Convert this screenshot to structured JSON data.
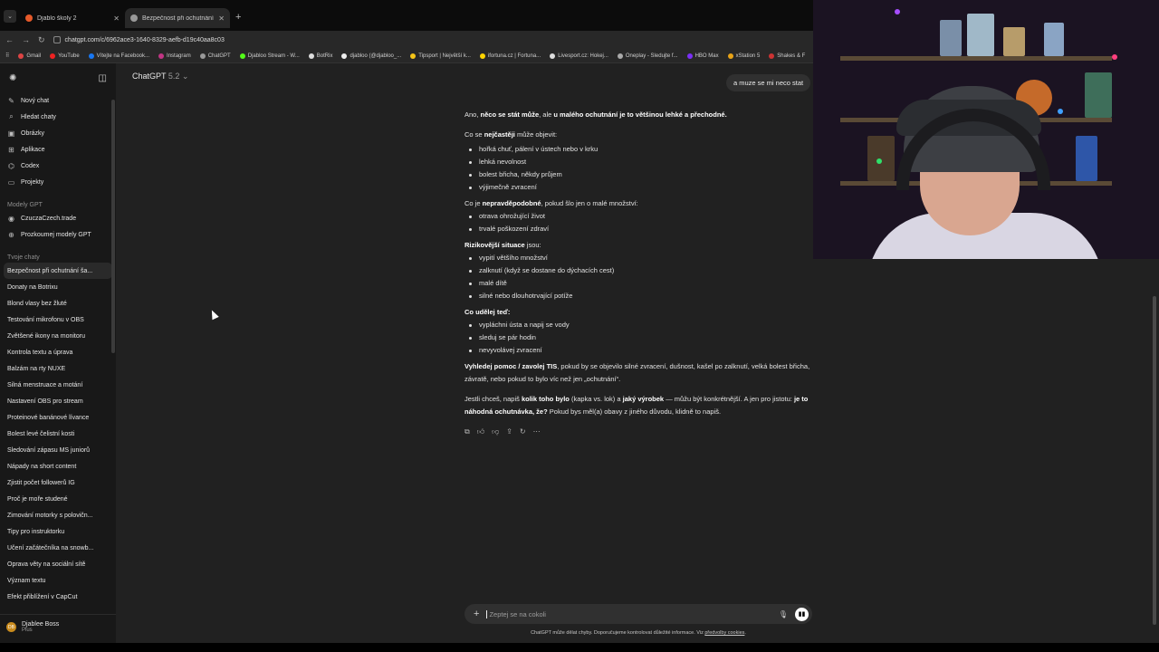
{
  "browser": {
    "tabs": [
      {
        "title": "Djablo školy 2",
        "active": false
      },
      {
        "title": "Bezpečnost při ochutnání šam...",
        "active": true
      }
    ],
    "url": "chatgpt.com/c/6962ace3-1640-8329-aefb-d19c40aa8c03",
    "bookmarks": [
      "Gmail",
      "YouTube",
      "Vítejte na Facebook...",
      "Instagram",
      "ChatGPT",
      "Djabloo Stream - W...",
      "BotRix",
      "djabloo (@djabloo_...",
      "Tipsport | Největší k...",
      "ifortuna.cz | Fortuna...",
      "Livesport.cz: Hokej...",
      "Oneplay - Sledujte f...",
      "HBO Max",
      "xStation 5",
      "Shakes & F"
    ]
  },
  "sidebar": {
    "nav": [
      {
        "icon": "edit-icon",
        "label": "Nový chat"
      },
      {
        "icon": "search-icon",
        "label": "Hledat chaty"
      },
      {
        "icon": "image-icon",
        "label": "Obrázky"
      },
      {
        "icon": "apps-icon",
        "label": "Aplikace"
      },
      {
        "icon": "code-icon",
        "label": "Codex"
      },
      {
        "icon": "folder-icon",
        "label": "Projekty"
      }
    ],
    "gpts_header": "Modely GPT",
    "gpts": [
      "CzuczaCzech.trade",
      "Prozkoumej modely GPT"
    ],
    "chats_header": "Tvoje chaty",
    "chats": [
      "Bezpečnost při ochutnání ša...",
      "Donaty na Botrixu",
      "Blond vlasy bez žluté",
      "Testování mikrofonu v OBS",
      "Zvětšené ikony na monitoru",
      "Kontrola textu a úprava",
      "Balzám na rty NUXE",
      "Silná menstruace a motání",
      "Nastavení OBS pro stream",
      "Proteinové banánové lívance",
      "Bolest levé čelistní kosti",
      "Sledování zápasu MS juniorů",
      "Nápady na short content",
      "Zjistit počet followerů IG",
      "Proč je moře studené",
      "Zimování motorky s polovičn...",
      "Tipy pro instruktorku",
      "Učení začátečníka na snowb...",
      "Oprava věty na sociální sítě",
      "Význam textu",
      "Efekt přiblížení v CapCut"
    ],
    "user": {
      "initials": "DB",
      "name": "Djablee Boss",
      "plan": "Plus"
    }
  },
  "header": {
    "model": "ChatGPT",
    "version": "5.2"
  },
  "conversation": {
    "user_message": "a muze se mi neco stat",
    "intro_a": "Ano, ",
    "intro_b": "něco se stát může",
    "intro_c": ", ale ",
    "intro_d": "u malého ochutnání je to většinou lehké a přechodné.",
    "common_a": "Co se ",
    "common_b": "nejčastěji",
    "common_c": " může objevit:",
    "common_items": [
      "hořká chuť, pálení v ústech nebo v krku",
      "lehká nevolnost",
      "bolest břicha, někdy průjem",
      "výjimečně zvracení"
    ],
    "unlikely_a": "Co je ",
    "unlikely_b": "nepravděpodobné",
    "unlikely_c": ", pokud šlo jen o malé množství:",
    "unlikely_items": [
      "otrava ohrožující život",
      "trvalé poškození zdraví"
    ],
    "risk_b": "Rizikovější situace",
    "risk_c": " jsou:",
    "risk_items": [
      "vypití většího množství",
      "zalknutí (když se dostane do dýchacích cest)",
      "malé dítě",
      "silné nebo dlouhotrvající potíže"
    ],
    "todo_h": "Co udělej teď:",
    "todo_items": [
      "vypláchni ústa a napij se vody",
      "sleduj se pár hodin",
      "nevyvolávej zvracení"
    ],
    "help_b": "Vyhledej pomoc / zavolej TIS",
    "help_c": ", pokud by se objevilo silné zvracení, dušnost, kašel po zalknutí, velká bolest břicha, závratě, nebo pokud to bylo víc než jen „ochutnání“.",
    "follow_a": "Jestli chceš, napiš ",
    "follow_b": "kolik toho bylo",
    "follow_c": " (kapka vs. lok) a ",
    "follow_d": "jaký výrobek",
    "follow_e": " — můžu být konkrétnější. A jen pro jistotu: ",
    "follow_f": "je to náhodná ochutnávka, že?",
    "follow_g": " Pokud bys měl(a) obavy z jiného důvodu, klidně to napiš."
  },
  "composer": {
    "placeholder": "Zeptej se na cokoli"
  },
  "footer": {
    "text": "ChatGPT může dělat chyby. Doporučujeme kontrolovat důležité informace. Viz ",
    "link": "předvolby cookies",
    "end": "."
  },
  "colors": {
    "background": "#212121",
    "sidebar": "#181818",
    "bubble": "#303030"
  }
}
